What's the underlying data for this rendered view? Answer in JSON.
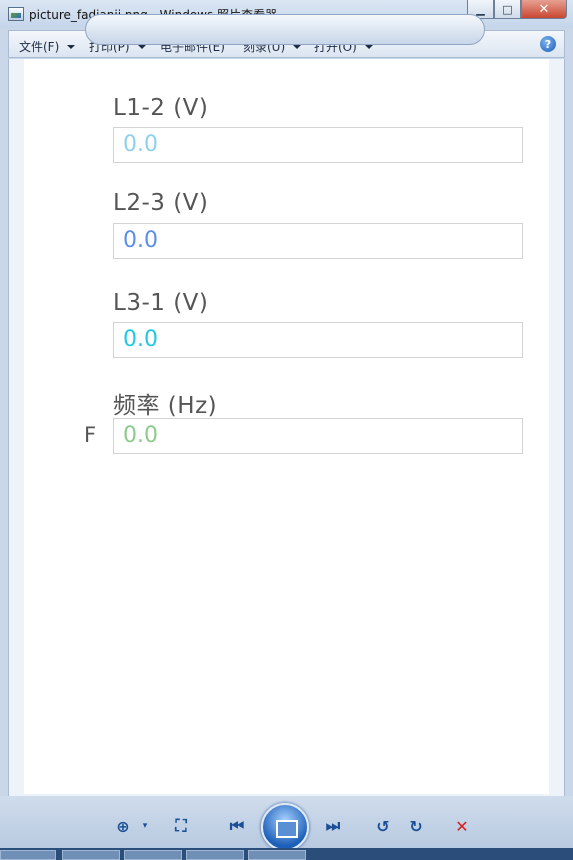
{
  "window": {
    "title": "picture_fadianji.png - Windows 照片查看器",
    "min_label": "▭",
    "max_label": "□",
    "close_label": "✕"
  },
  "menu": {
    "items": [
      {
        "label": "文件(F)"
      },
      {
        "label": "打印(P)"
      },
      {
        "label": "电子邮件(E)"
      },
      {
        "label": "刻录(U)"
      },
      {
        "label": "打开(O)"
      }
    ],
    "help": "?"
  },
  "content": {
    "fields": [
      {
        "label": "L1-2  (V)",
        "value": "0.0",
        "color": "#8fd0ee"
      },
      {
        "label": "L2-3  (V)",
        "value": "0.0",
        "color": "#5b8ee6"
      },
      {
        "label": "L3-1  (V)",
        "value": "0.0",
        "color": "#1fc8e6"
      },
      {
        "label": "频率 (Hz)",
        "value": "0.0",
        "color": "#8ccb8c",
        "side_label": "F"
      }
    ]
  },
  "toolbar": {
    "zoom_icon": "zoom-icon",
    "fit_icon": "fit-icon",
    "prev_icon": "previous-icon",
    "slideshow_icon": "slideshow-icon",
    "next_icon": "next-icon",
    "rotate_ccw_icon": "rotate-counterclockwise-icon",
    "rotate_cw_icon": "rotate-clockwise-icon",
    "delete_icon": "delete-icon"
  }
}
